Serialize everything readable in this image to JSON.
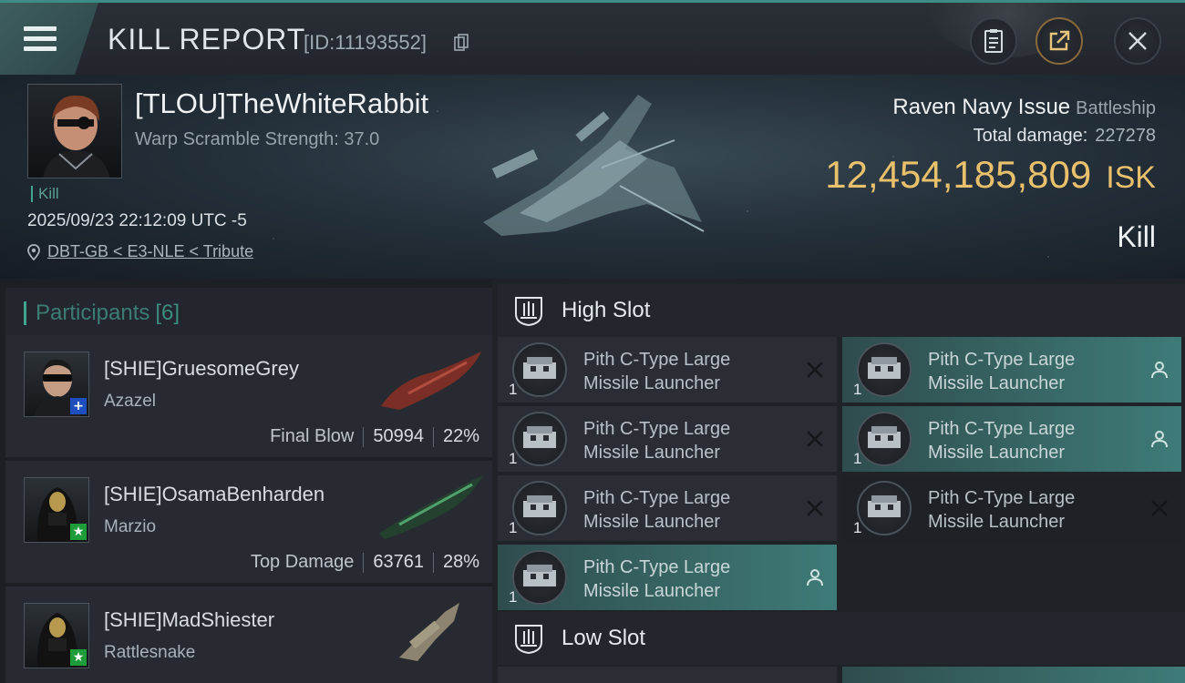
{
  "topbar": {
    "title": "KILL REPORT",
    "report_id": "[ID:11193552]",
    "icons": [
      "menu-icon",
      "copy-icon",
      "clipboard-icon",
      "share-icon",
      "close-icon"
    ]
  },
  "victim": {
    "name": "[TLOU]TheWhiteRabbit",
    "warp_scramble": "Warp Scramble Strength: 37.0",
    "kill_tag": "Kill",
    "datetime": "2025/09/23 22:12:09 UTC -5",
    "location": "DBT-GB < E3-NLE < Tribute",
    "ship_name": "Raven Navy Issue",
    "ship_class": "Battleship",
    "total_damage_label": "Total damage:",
    "total_damage": "227278",
    "isk_value": "12,454,185,809",
    "isk_unit": "ISK",
    "result": "Kill"
  },
  "participants": {
    "label": "Participants",
    "count": "[6]",
    "items": [
      {
        "name": "[SHIE]GruesomeGrey",
        "ship": "Azazel",
        "role": "Final Blow",
        "damage": "50994",
        "percent": "22%",
        "badge": "+",
        "badge_color": "#1f4fbf"
      },
      {
        "name": "[SHIE]OsamaBenharden",
        "ship": "Marzio",
        "role": "Top Damage",
        "damage": "63761",
        "percent": "28%",
        "badge": "★",
        "badge_color": "#1f9c3a"
      },
      {
        "name": "[SHIE]MadShiester",
        "ship": "Rattlesnake",
        "role": "",
        "damage": "",
        "percent": "",
        "badge": "★",
        "badge_color": "#1f9c3a"
      }
    ]
  },
  "slots": {
    "high_label": "High Slot",
    "low_label": "Low Slot",
    "high_modules": [
      {
        "line1": "Pith C-Type Large",
        "line2": "Missile Launcher",
        "qty": "1",
        "status": "destroyed"
      },
      {
        "line1": "Pith C-Type Large",
        "line2": "Missile Launcher",
        "qty": "1",
        "status": "dropped"
      },
      {
        "line1": "Pith C-Type Large",
        "line2": "Missile Launcher",
        "qty": "1",
        "status": "destroyed"
      },
      {
        "line1": "Pith C-Type Large",
        "line2": "Missile Launcher",
        "qty": "1",
        "status": "dropped"
      },
      {
        "line1": "Pith C-Type Large",
        "line2": "Missile Launcher",
        "qty": "1",
        "status": "destroyed"
      },
      {
        "line1": "Pith C-Type Large",
        "line2": "Missile Launcher",
        "qty": "1",
        "status": "destroyed"
      },
      {
        "line1": "Pith C-Type Large",
        "line2": "Missile Launcher",
        "qty": "1",
        "status": "dropped"
      }
    ]
  },
  "colors": {
    "accent": "#3fa58f",
    "isk": "#e9c06c",
    "equipped": "#3e7b78"
  }
}
